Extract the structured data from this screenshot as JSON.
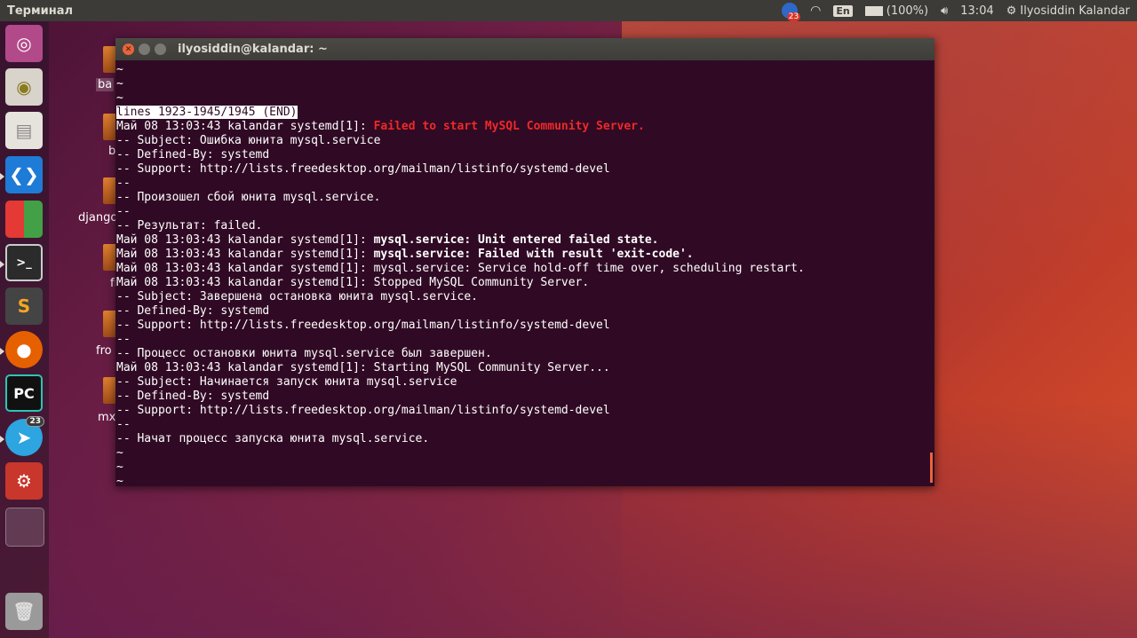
{
  "top_panel": {
    "app_title": "Терминал",
    "notification_count": "23",
    "keyboard_layout": "En",
    "battery": "(100%)",
    "time": "13:04",
    "user": "Ilyosiddin Kalandar"
  },
  "launcher": {
    "telegram_badge": "23"
  },
  "desktop": {
    "icons": [
      "ba",
      "b",
      "django",
      "fr",
      "fro",
      "mx"
    ]
  },
  "terminal": {
    "title": "ilyosiddin@kalandar: ~",
    "lines": [
      {
        "text": "~"
      },
      {
        "text": "~"
      },
      {
        "text": "~"
      },
      {
        "text": "lines 1923-1945/1945 (END)"
      },
      {
        "text": "Май 08 13:03:43 kalandar systemd[1]: ",
        "rest": "Failed to start MySQL Community Server."
      },
      {
        "text": "-- Subject: Ошибка юнита mysql.service"
      },
      {
        "text": "-- Defined-By: systemd"
      },
      {
        "text": "-- Support: http://lists.freedesktop.org/mailman/listinfo/systemd-devel"
      },
      {
        "text": "--"
      },
      {
        "text": "-- Произошел сбой юнита mysql.service."
      },
      {
        "text": "--"
      },
      {
        "text": "-- Результат: failed."
      },
      {
        "text": "Май 08 13:03:43 kalandar systemd[1]: ",
        "rest": "mysql.service: Unit entered failed state."
      },
      {
        "text": "Май 08 13:03:43 kalandar systemd[1]: ",
        "rest": "mysql.service: Failed with result 'exit-code'."
      },
      {
        "text": "Май 08 13:03:43 kalandar systemd[1]: mysql.service: Service hold-off time over, scheduling restart."
      },
      {
        "text": "Май 08 13:03:43 kalandar systemd[1]: Stopped MySQL Community Server."
      },
      {
        "text": "-- Subject: Завершена остановка юнита mysql.service."
      },
      {
        "text": "-- Defined-By: systemd"
      },
      {
        "text": "-- Support: http://lists.freedesktop.org/mailman/listinfo/systemd-devel"
      },
      {
        "text": "--"
      },
      {
        "text": "-- Процесс остановки юнита mysql.service был завершен."
      },
      {
        "text": "Май 08 13:03:43 kalandar systemd[1]: Starting MySQL Community Server..."
      },
      {
        "text": "-- Subject: Начинается запуск юнита mysql.service"
      },
      {
        "text": "-- Defined-By: systemd"
      },
      {
        "text": "-- Support: http://lists.freedesktop.org/mailman/listinfo/systemd-devel"
      },
      {
        "text": "--"
      },
      {
        "text": "-- Начат процесс запуска юнита mysql.service."
      },
      {
        "text": "~"
      },
      {
        "text": "~"
      },
      {
        "text": "~"
      }
    ]
  },
  "colors": {
    "terminal_bg": "#300a24",
    "error_red": "#ef2929",
    "accent_orange": "#e9643a",
    "panel": "#3c3b37"
  }
}
